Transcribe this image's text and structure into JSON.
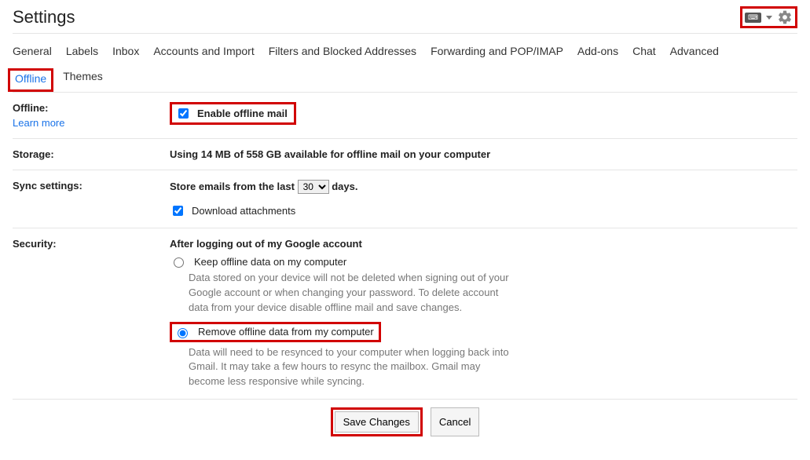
{
  "header": {
    "title": "Settings",
    "keyboard_label": "⌨"
  },
  "tabs_row1": [
    "General",
    "Labels",
    "Inbox",
    "Accounts and Import",
    "Filters and Blocked Addresses",
    "Forwarding and POP/IMAP",
    "Add-ons",
    "Chat",
    "Advanced"
  ],
  "tabs_row2": {
    "active": "Offline",
    "rest": [
      "Themes"
    ]
  },
  "offline": {
    "label": "Offline:",
    "learn_more": "Learn more",
    "enable_label": "Enable offline mail"
  },
  "storage": {
    "label": "Storage:",
    "text": "Using 14 MB of 558 GB available for offline mail on your computer"
  },
  "sync": {
    "label": "Sync settings:",
    "prefix": "Store emails from the last",
    "days_value": "30",
    "suffix": "days.",
    "download_label": "Download attachments"
  },
  "security": {
    "label": "Security:",
    "heading": "After logging out of my Google account",
    "keep_label": "Keep offline data on my computer",
    "keep_desc": "Data stored on your device will not be deleted when signing out of your Google account or when changing your password. To delete account data from your device disable offline mail and save changes.",
    "remove_label": "Remove offline data from my computer",
    "remove_desc": "Data will need to be resynced to your computer when logging back into Gmail. It may take a few hours to resync the mailbox. Gmail may become less responsive while syncing."
  },
  "buttons": {
    "save": "Save Changes",
    "cancel": "Cancel"
  }
}
